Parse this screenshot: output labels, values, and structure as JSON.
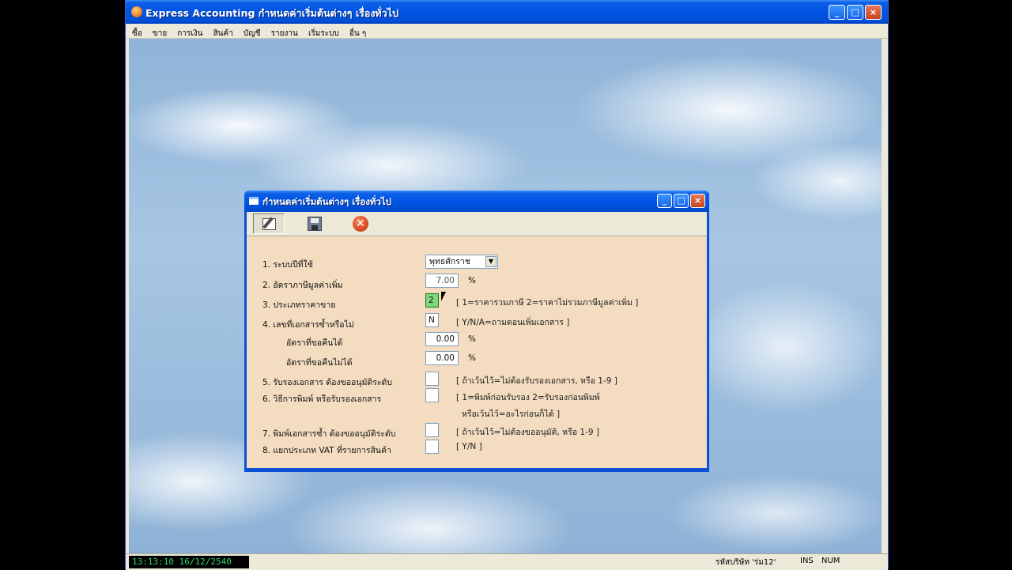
{
  "app": {
    "title": "Express Accounting  กำหนดค่าเริ่มต้นต่างๆ เรื่องทั่วไป",
    "window_buttons": {
      "minimize": "_",
      "maximize": "□",
      "close": "×"
    }
  },
  "menubar": {
    "items": [
      "ซื้อ",
      "ขาย",
      "การเงิน",
      "สินค้า",
      "บัญชี",
      "รายงาน",
      "เริ่มระบบ",
      "อื่น ๆ"
    ]
  },
  "statusbar": {
    "clock": "13:13:10 16/12/2540",
    "company": "รหัสบริษัท 'ร่ม12'",
    "ins": "INS",
    "num": "NUM"
  },
  "dialog": {
    "title": "กำหนดค่าเริ่มต้นต่างๆ เรื่องทั่วไป",
    "toolbar": {
      "edit_icon": "edit-icon",
      "save_icon": "save-icon",
      "close_icon": "close-icon",
      "close_glyph": "✕"
    },
    "fields": {
      "f1_label": "1. ระบบปีที่ใช้",
      "f1_value": "พุทธศักราช",
      "f1_arrow": "▼",
      "f2_label": "2. อัตราภาษีมูลค่าเพิ่ม",
      "f2_value": "7.00",
      "f2_unit": "%",
      "f3_label": "3. ประเภทราคาขาย",
      "f3_value": "2",
      "f3_hint": "[ 1=ราคารวมภาษี   2=ราคาไม่รวมภาษีมูลค่าเพิ่ม ]",
      "f4_label": "4. เลขที่เอกสารซ้ำหรือไม่",
      "f4_value": "N",
      "f4_hint": "[ Y/N/A=ถามตอนเพิ่มเอกสาร ]",
      "f4a_label": "อัตราที่ขอคืนได้",
      "f4a_value": "0.00",
      "f4a_unit": "%",
      "f4b_label": "อัตราที่ขอคืนไม่ได้",
      "f4b_value": "0.00",
      "f4b_unit": "%",
      "f5_label": "5. รับรองเอกสาร ต้องขออนุมัติระดับ",
      "f5_hint": "[ ถ้าเว้นไว้=ไม่ต้องรับรองเอกสาร,  หรือ 1-9 ]",
      "f6_label": "6. วิธีการพิมพ์ หรือรับรองเอกสาร",
      "f6_hint_1": "[ 1=พิมพ์ก่อนรับรอง  2=รับรองก่อนพิมพ์",
      "f6_hint_2": "หรือเว้นไว้=อะไรก่อนก็ได้ ]",
      "f7_label": "7. พิมพ์เอกสารซ้ำ ต้องขออนุมัติระดับ",
      "f7_hint": "[ ถ้าเว้นไว้=ไม่ต้องขออนุมัติ,  หรือ 1-9 ]",
      "f8_label": "8. แยกประเภท VAT ที่รายการสินค้า",
      "f8_hint": "[ Y/N ]"
    }
  }
}
